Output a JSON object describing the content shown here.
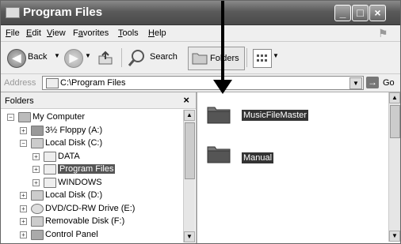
{
  "window": {
    "title": "Program Files"
  },
  "menubar": {
    "items": [
      {
        "label": "File",
        "u": "F"
      },
      {
        "label": "Edit",
        "u": "E"
      },
      {
        "label": "View",
        "u": "V"
      },
      {
        "label": "Favorites",
        "u": "a"
      },
      {
        "label": "Tools",
        "u": "T"
      },
      {
        "label": "Help",
        "u": "H"
      }
    ]
  },
  "toolbar": {
    "back_label": "Back",
    "search_label": "Search",
    "folders_label": "Folders"
  },
  "address": {
    "label": "Address",
    "value": "C:\\Program Files",
    "go_label": "Go"
  },
  "left_pane": {
    "title": "Folders",
    "tree": [
      {
        "label": "My Computer",
        "indent": 0,
        "expander": "−",
        "icon": "computer-icon"
      },
      {
        "label": "3½ Floppy (A:)",
        "indent": 1,
        "expander": "+",
        "icon": "floppy-icon"
      },
      {
        "label": "Local Disk (C:)",
        "indent": 1,
        "expander": "−",
        "icon": "disk-icon"
      },
      {
        "label": "DATA",
        "indent": 2,
        "expander": "+",
        "icon": "folder-icon"
      },
      {
        "label": "Program Files",
        "indent": 2,
        "expander": "+",
        "icon": "folder-icon",
        "selected": true
      },
      {
        "label": "WINDOWS",
        "indent": 2,
        "expander": "+",
        "icon": "folder-icon"
      },
      {
        "label": "Local Disk (D:)",
        "indent": 1,
        "expander": "+",
        "icon": "disk-icon"
      },
      {
        "label": "DVD/CD-RW Drive (E:)",
        "indent": 1,
        "expander": "+",
        "icon": "cd-icon"
      },
      {
        "label": "Removable Disk (F:)",
        "indent": 1,
        "expander": "+",
        "icon": "disk-icon"
      },
      {
        "label": "Control Panel",
        "indent": 1,
        "expander": "+",
        "icon": "control-panel-icon"
      }
    ]
  },
  "right_pane": {
    "items": [
      {
        "label": "MusicFileMaster"
      },
      {
        "label": "Manual"
      }
    ]
  },
  "colors": {
    "selection": "#333333",
    "titlebar": "#5a5a5a"
  }
}
